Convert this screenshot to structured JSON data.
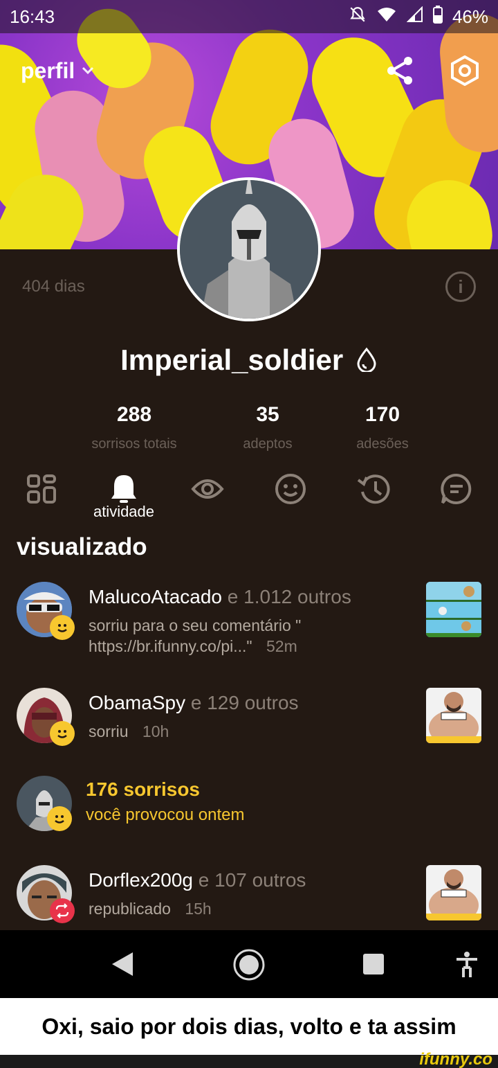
{
  "status_bar": {
    "time": "16:43",
    "battery": "46%"
  },
  "header": {
    "title": "perfil"
  },
  "profile": {
    "days": "404 dias",
    "username": "Imperial_soldier",
    "stats": [
      {
        "value": "288",
        "label": "sorrisos totais"
      },
      {
        "value": "35",
        "label": "adeptos"
      },
      {
        "value": "170",
        "label": "adesões"
      }
    ]
  },
  "tabs": {
    "active_label": "atividade"
  },
  "section": {
    "title": "visualizado"
  },
  "activity": [
    {
      "name": "MalucoAtacado",
      "others": "e 1.012 outros",
      "text": "sorriu para o seu comentário \" https://br.ifunny.co/pi...\"",
      "time": "52m"
    },
    {
      "name": "ObamaSpy",
      "others": "e 129 outros",
      "text": "sorriu",
      "time": "10h"
    },
    {
      "name": "176 sorrisos",
      "text": "você provocou ontem"
    },
    {
      "name": "Dorflex200g",
      "others": "e 107 outros",
      "text": "republicado",
      "time": "15h"
    }
  ],
  "caption": "Oxi, saio por dois dias, volto e ta assim",
  "watermark": "ifunny.co",
  "colors": {
    "accent_yellow": "#f7c72f",
    "panel": "#231913",
    "muted": "#8c8178"
  }
}
